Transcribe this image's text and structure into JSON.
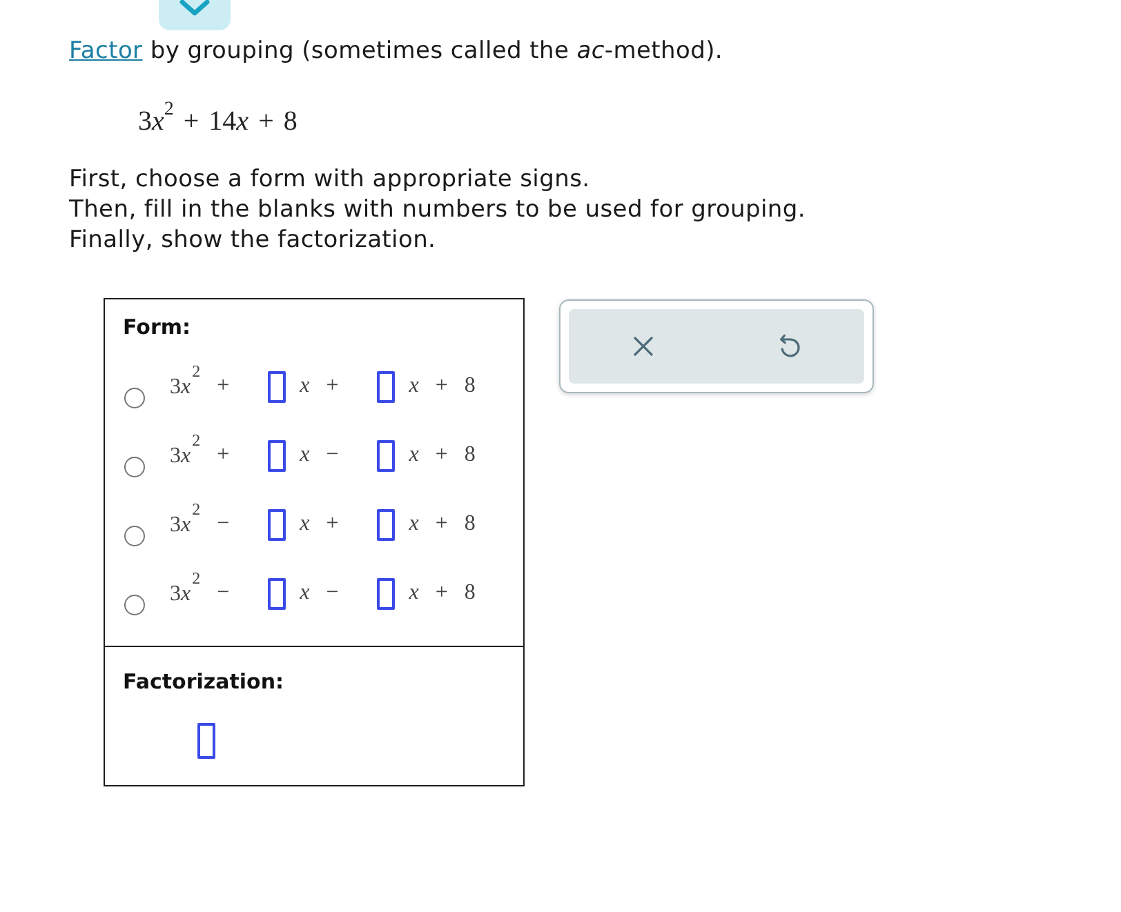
{
  "prompt": {
    "link": "Factor",
    "text": "by grouping (sometimes called the *ac*-method)."
  },
  "expression": {
    "parts": [
      {
        "kind": "term",
        "coefficient": "3",
        "variable": "x",
        "exponent": "2"
      },
      {
        "kind": "sign",
        "text": "+"
      },
      {
        "kind": "term",
        "coefficient": "14",
        "variable": "x"
      },
      {
        "kind": "sign",
        "text": "+"
      },
      {
        "kind": "term",
        "coefficient": "8"
      }
    ]
  },
  "instructions": [
    "First, choose a form with appropriate signs.",
    "Then, fill in the blanks with numbers to be used for grouping.",
    "Finally, show the factorization."
  ],
  "form": {
    "label": "Form:",
    "options": [
      {
        "selected": false,
        "parts": [
          {
            "kind": "term",
            "coefficient": "3",
            "variable": "x",
            "exponent": "2"
          },
          {
            "kind": "sign",
            "text": "+"
          },
          {
            "kind": "blank"
          },
          {
            "kind": "term",
            "variable": "x"
          },
          {
            "kind": "sign",
            "text": "+"
          },
          {
            "kind": "blank"
          },
          {
            "kind": "term",
            "variable": "x"
          },
          {
            "kind": "sign",
            "text": "+"
          },
          {
            "kind": "term",
            "coefficient": "8"
          }
        ]
      },
      {
        "selected": false,
        "parts": [
          {
            "kind": "term",
            "coefficient": "3",
            "variable": "x",
            "exponent": "2"
          },
          {
            "kind": "sign",
            "text": "+"
          },
          {
            "kind": "blank"
          },
          {
            "kind": "term",
            "variable": "x"
          },
          {
            "kind": "sign",
            "text": "−"
          },
          {
            "kind": "blank"
          },
          {
            "kind": "term",
            "variable": "x"
          },
          {
            "kind": "sign",
            "text": "+"
          },
          {
            "kind": "term",
            "coefficient": "8"
          }
        ]
      },
      {
        "selected": false,
        "parts": [
          {
            "kind": "term",
            "coefficient": "3",
            "variable": "x",
            "exponent": "2"
          },
          {
            "kind": "sign",
            "text": "−"
          },
          {
            "kind": "blank"
          },
          {
            "kind": "term",
            "variable": "x"
          },
          {
            "kind": "sign",
            "text": "+"
          },
          {
            "kind": "blank"
          },
          {
            "kind": "term",
            "variable": "x"
          },
          {
            "kind": "sign",
            "text": "+"
          },
          {
            "kind": "term",
            "coefficient": "8"
          }
        ]
      },
      {
        "selected": false,
        "parts": [
          {
            "kind": "term",
            "coefficient": "3",
            "variable": "x",
            "exponent": "2"
          },
          {
            "kind": "sign",
            "text": "−"
          },
          {
            "kind": "blank"
          },
          {
            "kind": "term",
            "variable": "x"
          },
          {
            "kind": "sign",
            "text": "−"
          },
          {
            "kind": "blank"
          },
          {
            "kind": "term",
            "variable": "x"
          },
          {
            "kind": "sign",
            "text": "+"
          },
          {
            "kind": "term",
            "coefficient": "8"
          }
        ]
      }
    ]
  },
  "factorization": {
    "label": "Factorization:",
    "parts": [
      {
        "kind": "blank"
      }
    ]
  },
  "tools": [
    {
      "kind": "clear"
    },
    {
      "kind": "undo"
    }
  ]
}
